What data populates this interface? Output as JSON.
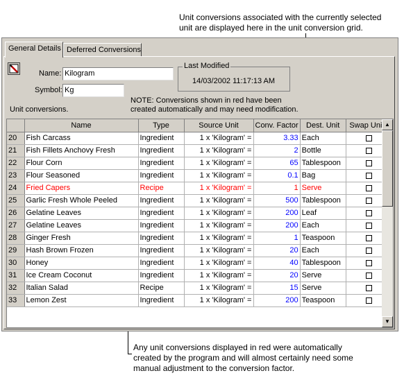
{
  "callouts": {
    "top": "Unit conversions associated with the currently selected\nunit are displayed here in the unit conversion grid.",
    "bottom": "Any unit conversions displayed in red were automatically\ncreated by the program and will almost certainly need some\nmanual adjustment to the conversion factor."
  },
  "tabs": {
    "general": "General Details",
    "deferred": "Deferred Conversions"
  },
  "form": {
    "name_label": "Name:",
    "name_value": "Kilogram",
    "symbol_label": "Symbol:",
    "symbol_value": "Kg",
    "last_modified_label": "Last Modified",
    "last_modified_value": "14/03/2002 11:17:13 AM",
    "note": "NOTE: Conversions shown in red have been\ncreated automatically and may need modification.",
    "unit_conversions_label": "Unit conversions."
  },
  "grid": {
    "columns": [
      "Name",
      "Type",
      "Source Unit",
      "Conv. Factor",
      "Dest. Unit",
      "Swap Units"
    ],
    "rows": [
      {
        "num": "20",
        "name": "Fish Carcass",
        "type": "Ingredient",
        "source": "1 x 'Kilogram' =",
        "factor": "3.33",
        "dest": "Each",
        "red": false
      },
      {
        "num": "21",
        "name": "Fish Fillets Anchovy Fresh",
        "type": "Ingredient",
        "source": "1 x 'Kilogram' =",
        "factor": "2",
        "dest": "Bottle",
        "red": false
      },
      {
        "num": "22",
        "name": "Flour Corn",
        "type": "Ingredient",
        "source": "1 x 'Kilogram' =",
        "factor": "65",
        "dest": "Tablespoon",
        "red": false
      },
      {
        "num": "23",
        "name": "Flour Seasoned",
        "type": "Ingredient",
        "source": "1 x 'Kilogram' =",
        "factor": "0.1",
        "dest": "Bag",
        "red": false
      },
      {
        "num": "24",
        "name": "Fried Capers",
        "type": "Recipe",
        "source": "1 x 'Kilogram' =",
        "factor": "1",
        "dest": "Serve",
        "red": true
      },
      {
        "num": "25",
        "name": "Garlic Fresh Whole Peeled",
        "type": "Ingredient",
        "source": "1 x 'Kilogram' =",
        "factor": "500",
        "dest": "Tablespoon",
        "red": false
      },
      {
        "num": "26",
        "name": "Gelatine Leaves",
        "type": "Ingredient",
        "source": "1 x 'Kilogram' =",
        "factor": "200",
        "dest": "Leaf",
        "red": false
      },
      {
        "num": "27",
        "name": "Gelatine Leaves",
        "type": "Ingredient",
        "source": "1 x 'Kilogram' =",
        "factor": "200",
        "dest": "Each",
        "red": false
      },
      {
        "num": "28",
        "name": "Ginger Fresh",
        "type": "Ingredient",
        "source": "1 x 'Kilogram' =",
        "factor": "1",
        "dest": "Teaspoon",
        "red": false
      },
      {
        "num": "29",
        "name": "Hash Brown Frozen",
        "type": "Ingredient",
        "source": "1 x 'Kilogram' =",
        "factor": "20",
        "dest": "Each",
        "red": false
      },
      {
        "num": "30",
        "name": "Honey",
        "type": "Ingredient",
        "source": "1 x 'Kilogram' =",
        "factor": "40",
        "dest": "Tablespoon",
        "red": false
      },
      {
        "num": "31",
        "name": "Ice Cream Coconut",
        "type": "Ingredient",
        "source": "1 x 'Kilogram' =",
        "factor": "20",
        "dest": "Serve",
        "red": false
      },
      {
        "num": "32",
        "name": "Italian Salad",
        "type": "Recipe",
        "source": "1 x 'Kilogram' =",
        "factor": "15",
        "dest": "Serve",
        "red": false
      },
      {
        "num": "33",
        "name": "Lemon Zest",
        "type": "Ingredient",
        "source": "1 x 'Kilogram' =",
        "factor": "200",
        "dest": "Teaspoon",
        "red": false
      }
    ]
  }
}
